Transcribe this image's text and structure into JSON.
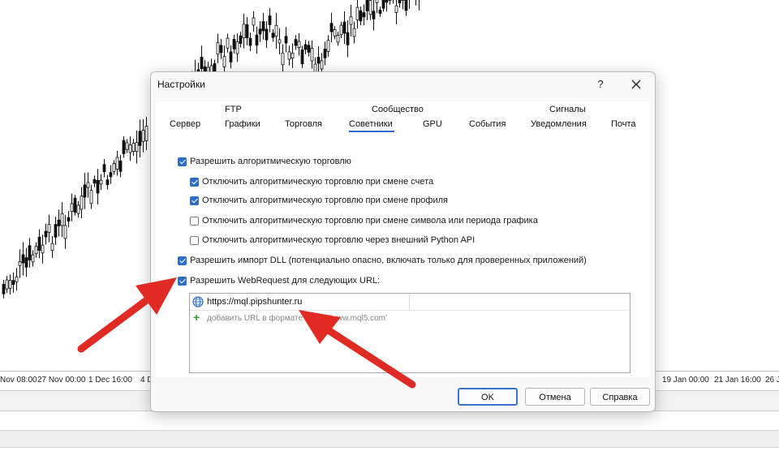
{
  "colors": {
    "accent": "#2f6ec7",
    "arrow": "#e02b25",
    "add_icon": "#2e9e2e"
  },
  "date_axis": [
    "Nov 08:00",
    "27 Nov 00:00",
    "1 Dec 16:00",
    "4 D",
    "19 Jan 00:00",
    "21 Jan 16:00",
    "26 J"
  ],
  "dialog": {
    "title": "Настройки",
    "help_label": "?",
    "close_icon": "close-icon",
    "tabs": {
      "ftp": "FTP",
      "community": "Сообщество",
      "signals": "Сигналы",
      "server": "Сервер",
      "charts": "Графики",
      "trade": "Торговля",
      "experts": "Советники",
      "gpu": "GPU",
      "events": "События",
      "notifications": "Уведомления",
      "email": "Почта",
      "active": "Советники"
    },
    "options": [
      {
        "label": "Разрешить алгоритмическую торговлю",
        "checked": true
      },
      {
        "label": "Отключить алгоритмическую торговлю при смене счета",
        "checked": true
      },
      {
        "label": "Отключить алгоритмическую торговлю при смене профиля",
        "checked": true
      },
      {
        "label": "Отключить алгоритмическую торговлю при смене символа или периода графика",
        "checked": false
      },
      {
        "label": "Отключить алгоритмическую торговлю через внешний Python API",
        "checked": false
      },
      {
        "label": "Разрешить импорт DLL (потенциально опасно, включать только для проверенных приложений)",
        "checked": true
      },
      {
        "label": "Разрешить WebRequest для следующих URL:",
        "checked": true
      }
    ],
    "url_list": {
      "url": "https://mql.pipshunter.ru",
      "url_icon": "globe-icon",
      "add_icon": "plus-icon",
      "add_hint": "добавить URL в формате 'https://www.mql5.com'"
    },
    "buttons": {
      "ok": "OK",
      "cancel": "Отмена",
      "help": "Справка"
    }
  }
}
